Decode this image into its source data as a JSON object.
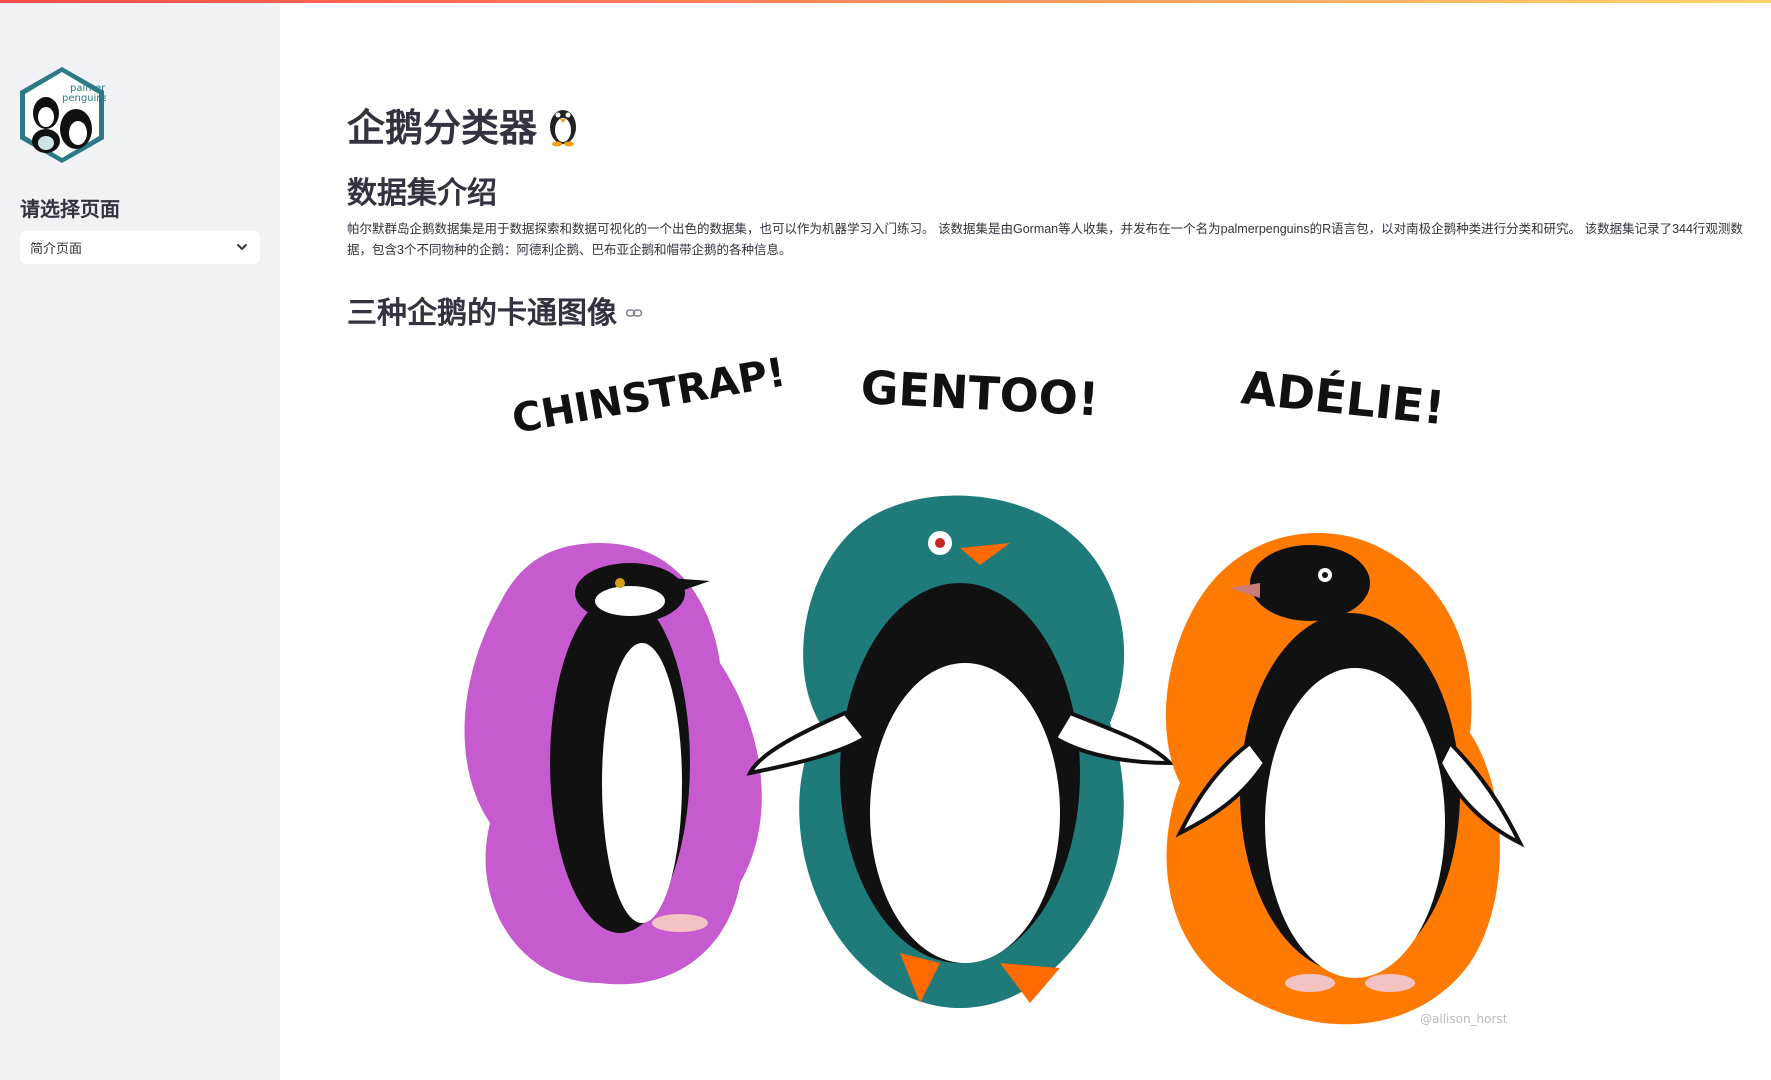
{
  "sidebar": {
    "logo_text": "palmer penguins",
    "title": "请选择页面",
    "select_value": "简介页面"
  },
  "main": {
    "title": "企鹅分类器",
    "intro_heading": "数据集介绍",
    "intro_line1": "帕尔默群岛企鹅数据集是用于数据探索和数据可视化的一个出色的数据集，也可以作为机器学习入门练习。 该数据集是由Gorman等人收集，并发布在一个名为palmerpenguins的R语言包，以对南极企鹅种类进行分类和研究。 该数据集记录了344行观测数",
    "intro_line2": "据，包含3个不同物种的企鹅：阿德利企鹅、巴布亚企鹅和帽带企鹅的各种信息。",
    "cartoon_heading": "三种企鹅的卡通图像"
  },
  "art": {
    "labels": [
      "CHINSTRAP!",
      "GENTOO!",
      "ADÉLIE!"
    ],
    "signature": "@allison_horst",
    "colors": {
      "chinstrap": "#c65bcf",
      "gentoo": "#1f7a7a",
      "adelie": "#ff7a00"
    }
  }
}
